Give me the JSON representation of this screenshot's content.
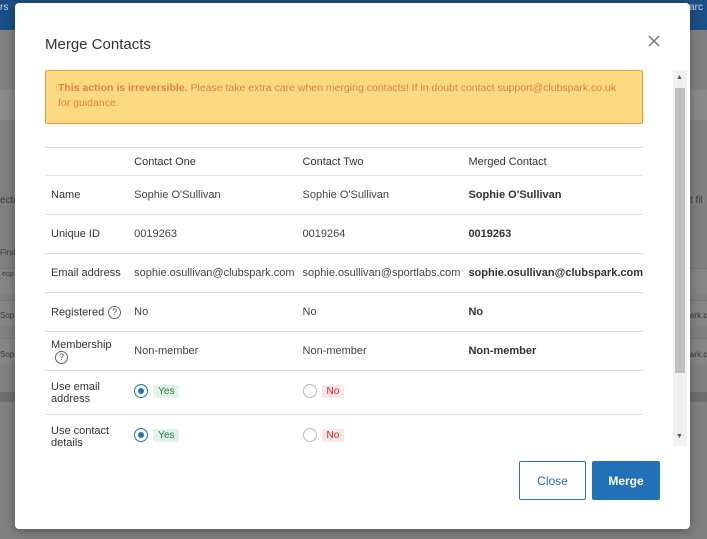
{
  "background": {
    "topbar_left": "rs",
    "topbar_right": "arc",
    "side_texts": [
      "ecte",
      "First",
      "eop",
      "Sop",
      "Sop"
    ],
    "right_texts": [
      "t fil",
      "ark.c",
      "ark.c"
    ]
  },
  "modal": {
    "title": "Merge Contacts",
    "warning_bold": "This action is irreversible.",
    "warning_text": " Please take extra care when merging contacts! If in doubt contact support@clubspark.co.uk for guidance.",
    "columns": [
      "Contact One",
      "Contact Two",
      "Merged Contact"
    ],
    "rows": [
      {
        "label": "Name",
        "help": false,
        "values": [
          "Sophie O'Sullivan",
          "Sophie O'Sullivan",
          "Sophie O'Sullivan"
        ]
      },
      {
        "label": "Unique ID",
        "help": false,
        "values": [
          "0019263",
          "0019264",
          "0019263"
        ]
      },
      {
        "label": "Email address",
        "help": false,
        "values": [
          "sophie.osullivan@clubspark.com",
          "sophie.osullivan@sportlabs.com",
          "sophie.osullivan@clubspark.com"
        ]
      },
      {
        "label": "Registered",
        "help": true,
        "values": [
          "No",
          "No",
          "No"
        ]
      },
      {
        "label": "Membership",
        "help": true,
        "values": [
          "Non-member",
          "Non-member",
          "Non-member"
        ]
      }
    ],
    "radio_rows": [
      {
        "label": "Use email address",
        "option_one": "Yes",
        "option_two": "No"
      },
      {
        "label": "Use contact details",
        "option_one": "Yes",
        "option_two": "No"
      }
    ],
    "help_glyph": "?",
    "close_label": "Close",
    "merge_label": "Merge"
  }
}
